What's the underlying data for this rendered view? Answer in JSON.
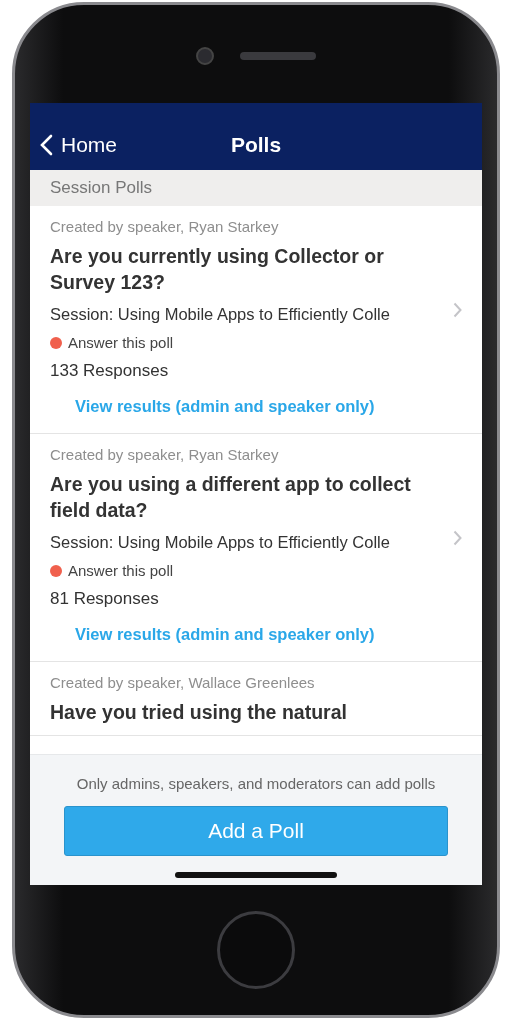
{
  "nav": {
    "back": "Home",
    "title": "Polls"
  },
  "section": "Session Polls",
  "polls": [
    {
      "creator": "Created by speaker, Ryan Starkey",
      "question": "Are you currently using Collector or Survey 123?",
      "session": "Session: Using Mobile Apps to Efficiently Colle",
      "status": {
        "label": "Answer this poll",
        "color": "#f0604d"
      },
      "responses": "133 Responses",
      "link": "View results (admin and speaker only)"
    },
    {
      "creator": "Created by speaker, Ryan Starkey",
      "question": "Are you using a different app to collect field data?",
      "session": "Session: Using Mobile Apps to Efficiently Colle",
      "status": {
        "label": "Answer this poll",
        "color": "#f0604d"
      },
      "responses": "81 Responses",
      "link": "View results (admin and speaker only)"
    },
    {
      "creator": "Created by speaker, Wallace Greenlees",
      "question": "Have you tried using the natural"
    }
  ],
  "footer": {
    "note": "Only admins, speakers, and moderators can add polls",
    "button": "Add a Poll"
  }
}
